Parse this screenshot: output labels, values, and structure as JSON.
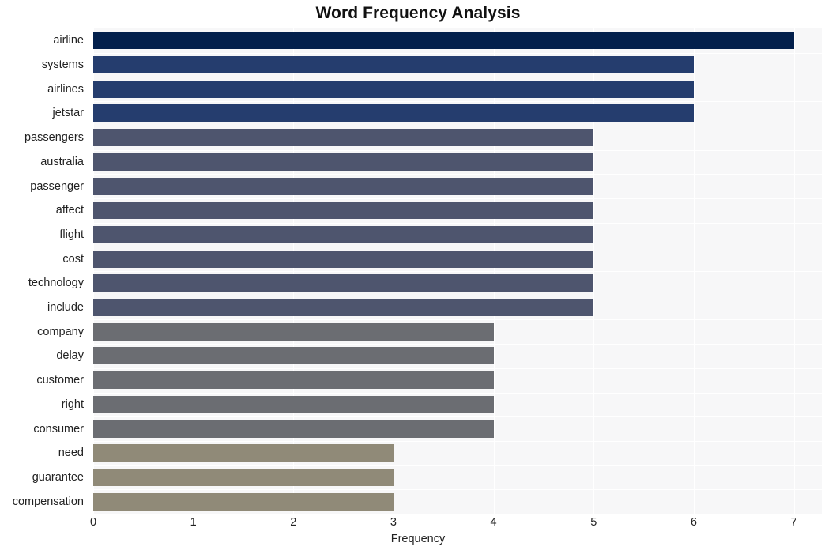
{
  "chart_data": {
    "type": "bar",
    "orientation": "horizontal",
    "title": "Word Frequency Analysis",
    "xlabel": "Frequency",
    "ylabel": "",
    "xlim": [
      0,
      7.28
    ],
    "xticks": [
      0,
      1,
      2,
      3,
      4,
      5,
      6,
      7
    ],
    "xtick_labels": [
      "0",
      "1",
      "2",
      "3",
      "4",
      "5",
      "6",
      "7"
    ],
    "grid": true,
    "legend": null,
    "categories": [
      "airline",
      "systems",
      "airlines",
      "jetstar",
      "passengers",
      "australia",
      "passenger",
      "affect",
      "flight",
      "cost",
      "technology",
      "include",
      "company",
      "delay",
      "customer",
      "right",
      "consumer",
      "need",
      "guarantee",
      "compensation"
    ],
    "values": [
      7,
      6,
      6,
      6,
      5,
      5,
      5,
      5,
      5,
      5,
      5,
      5,
      4,
      4,
      4,
      4,
      4,
      3,
      3,
      3
    ],
    "bar_colors": [
      "#03204c",
      "#253d6e",
      "#253d6e",
      "#253d6e",
      "#4e556e",
      "#4e556e",
      "#4e556e",
      "#4e556e",
      "#4e556e",
      "#4e556e",
      "#4e556e",
      "#4e556e",
      "#6b6d72",
      "#6b6d72",
      "#6b6d72",
      "#6b6d72",
      "#6b6d72",
      "#908a78",
      "#908a78",
      "#908a78"
    ]
  },
  "style": {
    "page_background": "#ffffff",
    "plot_background": "#f7f7f8",
    "gridline_color": "#ffffff",
    "text_color": "#222222",
    "title_color": "#111111"
  }
}
